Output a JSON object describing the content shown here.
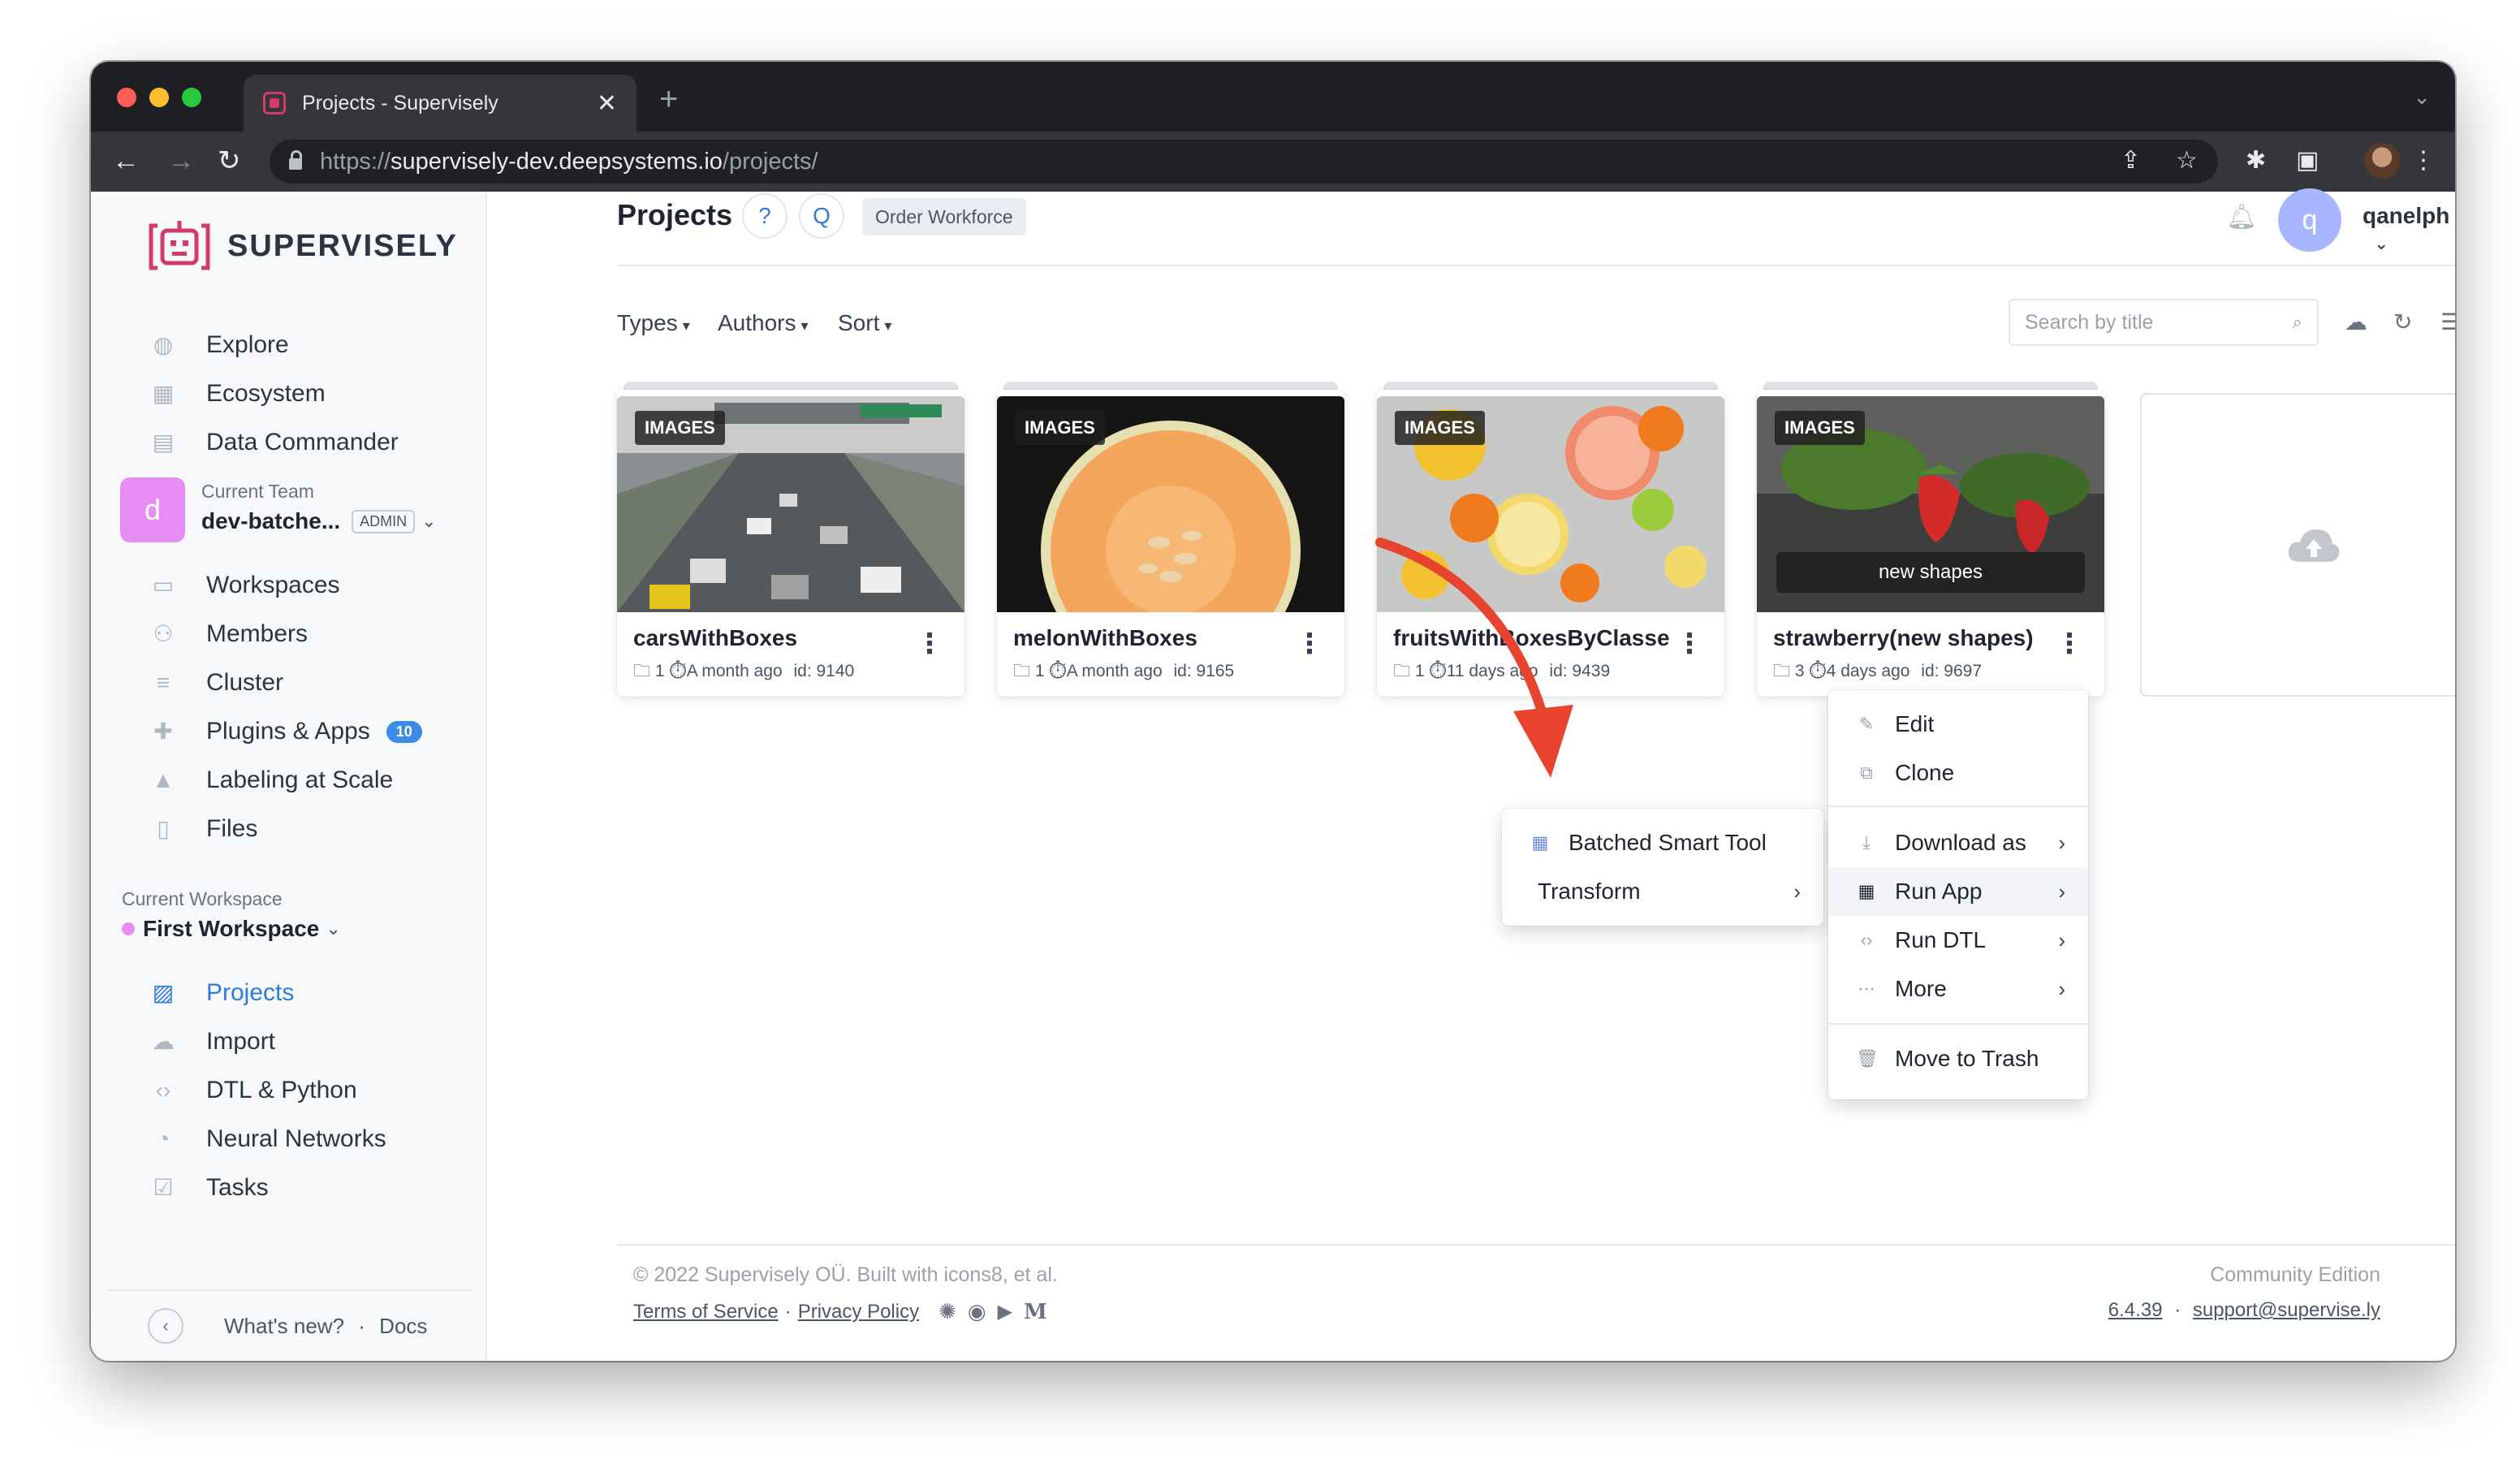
{
  "browser": {
    "tab_title": "Projects - Supervisely",
    "url_scheme": "https://",
    "url_host": "supervisely-dev.deepsystems.io",
    "url_path": "/projects/"
  },
  "sidebar": {
    "brand": "SUPERVISELY",
    "top_items": [
      {
        "label": "Explore",
        "icon": "globe-icon"
      },
      {
        "label": "Ecosystem",
        "icon": "grid-icon"
      },
      {
        "label": "Data Commander",
        "icon": "folder-icon"
      }
    ],
    "team": {
      "label": "Current Team",
      "avatar_letter": "d",
      "name": "dev-batche...",
      "role": "ADMIN"
    },
    "team_items": [
      {
        "label": "Workspaces",
        "icon": "monitor-icon"
      },
      {
        "label": "Members",
        "icon": "users-icon"
      },
      {
        "label": "Cluster",
        "icon": "list-icon"
      },
      {
        "label": "Plugins & Apps",
        "icon": "puzzle-icon",
        "badge": "10"
      },
      {
        "label": "Labeling at Scale",
        "icon": "graduation-icon"
      },
      {
        "label": "Files",
        "icon": "file-icon"
      }
    ],
    "workspace": {
      "label": "Current Workspace",
      "name": "First Workspace"
    },
    "workspace_items": [
      {
        "label": "Projects",
        "icon": "images-icon",
        "active": true
      },
      {
        "label": "Import",
        "icon": "cloud-icon"
      },
      {
        "label": "DTL & Python",
        "icon": "code-icon"
      },
      {
        "label": "Neural Networks",
        "icon": "brain-icon"
      },
      {
        "label": "Tasks",
        "icon": "clipboard-icon"
      }
    ],
    "footer": {
      "whats_new": "What's new?",
      "sep": "·",
      "docs": "Docs"
    }
  },
  "header": {
    "title": "Projects",
    "help": "?",
    "q": "Q",
    "order": "Order Workforce",
    "user_initial": "q",
    "user_name": "qanelph"
  },
  "filters": {
    "types": "Types",
    "authors": "Authors",
    "sort": "Sort",
    "search_placeholder": "Search by title"
  },
  "projects": [
    {
      "badge": "IMAGES",
      "title": "carsWithBoxes",
      "count": "1",
      "time": "A month ago",
      "id": "id: 9140",
      "caption": ""
    },
    {
      "badge": "IMAGES",
      "title": "melonWithBoxes",
      "count": "1",
      "time": "A month ago",
      "id": "id: 9165",
      "caption": ""
    },
    {
      "badge": "IMAGES",
      "title": "fruitsWithBoxesByClasses",
      "count": "1",
      "time": "11 days ago",
      "id": "id: 9439",
      "caption": ""
    },
    {
      "badge": "IMAGES",
      "title": "strawberry(new shapes)",
      "count": "3",
      "time": "4 days ago",
      "id": "id: 9697",
      "caption": "new shapes"
    }
  ],
  "context_menu": {
    "edit": "Edit",
    "clone": "Clone",
    "download": "Download as",
    "run_app": "Run App",
    "run_dtl": "Run DTL",
    "more": "More",
    "trash": "Move to Trash"
  },
  "submenu": {
    "batched": "Batched Smart Tool",
    "transform": "Transform"
  },
  "footer": {
    "copyright": "© 2022 Supervisely OÜ. Built with icons8, et al.",
    "terms": "Terms of Service",
    "dot": "·",
    "privacy": "Privacy Policy",
    "edition": "Community Edition",
    "version": "6.4.39",
    "support": "support@supervise.ly"
  },
  "colors": {
    "accent": "#2f7bd9",
    "brand": "#d33b6c",
    "annotation_arrow": "#e8432f"
  }
}
